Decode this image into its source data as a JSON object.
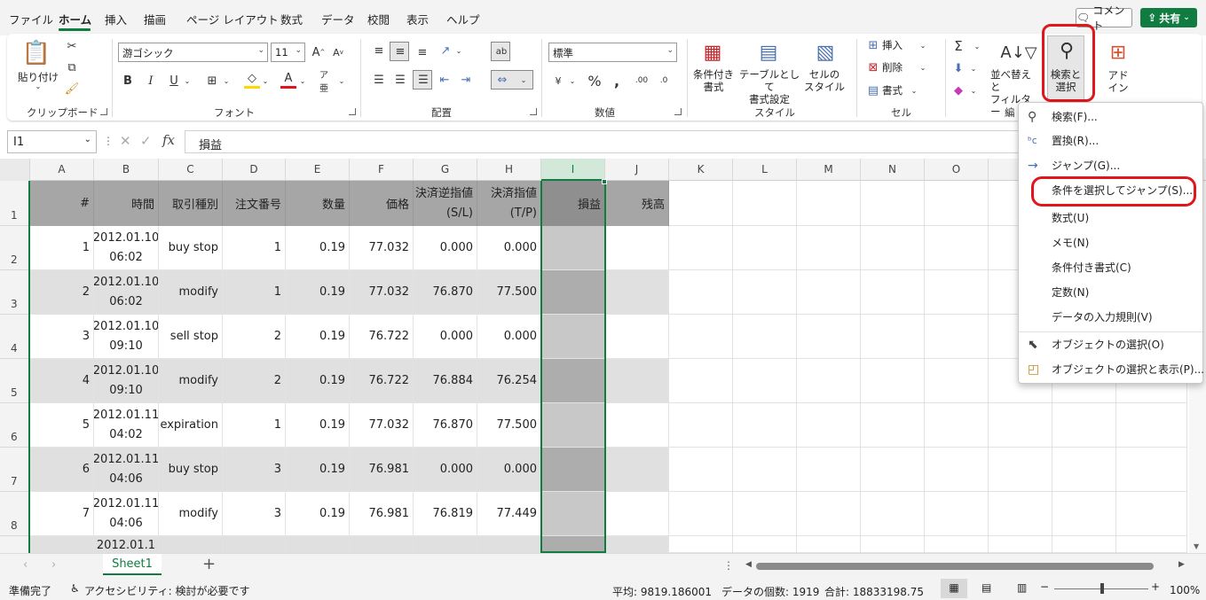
{
  "menu": {
    "tabs": [
      "ファイル",
      "ホーム",
      "挿入",
      "描画",
      "ページ レイアウト",
      "数式",
      "データ",
      "校閲",
      "表示",
      "ヘルプ"
    ],
    "comment": "コメント",
    "share": "共有"
  },
  "ribbon": {
    "clipboard": {
      "paste": "貼り付け",
      "label": "クリップボード"
    },
    "font": {
      "name": "游ゴシック",
      "size": "11",
      "label": "フォント",
      "bold": "B",
      "italic": "I",
      "underline": "U"
    },
    "alignment": {
      "label": "配置"
    },
    "number": {
      "format": "標準",
      "label": "数値",
      "percent": "%"
    },
    "styles": {
      "conditional": "条件付き\n書式",
      "table": "テーブルとして\n書式設定",
      "cell": "セルの\nスタイル",
      "label": "スタイル"
    },
    "cells": {
      "insert": "挿入",
      "delete": "削除",
      "format": "書式",
      "label": "セル"
    },
    "editing": {
      "sort": "並べ替えと\nフィルター",
      "find": "検索と\n選択",
      "label": "編"
    },
    "addin": {
      "label": "アド\nイン"
    }
  },
  "formula_bar": {
    "name_box": "I1",
    "formula": "損益"
  },
  "columns": [
    "A",
    "B",
    "C",
    "D",
    "E",
    "F",
    "G",
    "H",
    "I",
    "J",
    "K",
    "L",
    "M",
    "N",
    "O"
  ],
  "rows": [
    "1",
    "2",
    "3",
    "4",
    "5",
    "6",
    "7",
    "8"
  ],
  "table": {
    "headers": [
      "#",
      "時間",
      "取引種別",
      "注文番号",
      "数量",
      "価格",
      "決済逆指値(S/L)",
      "決済指値(T/P)",
      "損益",
      "残高"
    ],
    "data": [
      [
        "1",
        "2012.01.10 06:02",
        "buy stop",
        "1",
        "0.19",
        "77.032",
        "0.000",
        "0.000"
      ],
      [
        "2",
        "2012.01.10 06:02",
        "modify",
        "1",
        "0.19",
        "77.032",
        "76.870",
        "77.500"
      ],
      [
        "3",
        "2012.01.10 09:10",
        "sell stop",
        "2",
        "0.19",
        "76.722",
        "0.000",
        "0.000"
      ],
      [
        "4",
        "2012.01.10 09:10",
        "modify",
        "2",
        "0.19",
        "76.722",
        "76.884",
        "76.254"
      ],
      [
        "5",
        "2012.01.11 04:02",
        "expiration",
        "1",
        "0.19",
        "77.032",
        "76.870",
        "77.500"
      ],
      [
        "6",
        "2012.01.11 04:06",
        "buy stop",
        "3",
        "0.19",
        "76.981",
        "0.000",
        "0.000"
      ],
      [
        "7",
        "2012.01.11 04:06",
        "modify",
        "3",
        "0.19",
        "76.981",
        "76.819",
        "77.449"
      ]
    ],
    "partial_date": "2012.01.1"
  },
  "dropdown": {
    "items": [
      {
        "label": "検索(F)...",
        "icon": "search-icon"
      },
      {
        "label": "置換(R)...",
        "icon": "replace-icon"
      },
      {
        "label": "ジャンプ(G)...",
        "icon": "arrow-right-icon"
      },
      {
        "label": "条件を選択してジャンプ(S)...",
        "icon": ""
      },
      {
        "label": "数式(U)",
        "icon": ""
      },
      {
        "label": "メモ(N)",
        "icon": ""
      },
      {
        "label": "条件付き書式(C)",
        "icon": ""
      },
      {
        "label": "定数(N)",
        "icon": ""
      },
      {
        "label": "データの入力規則(V)",
        "icon": ""
      },
      {
        "label": "オブジェクトの選択(O)",
        "icon": "pointer-icon"
      },
      {
        "label": "オブジェクトの選択と表示(P)...",
        "icon": "selection-pane-icon"
      }
    ]
  },
  "sheet": {
    "tab": "Sheet1"
  },
  "status": {
    "ready": "準備完了",
    "accessibility": "アクセシビリティ: 検討が必要です",
    "average": "平均: 9819.186001",
    "count": "データの個数: 1919",
    "sum": "合計: 18833198.75",
    "zoom": "100%"
  },
  "colors": {
    "accent": "#107c41",
    "highlight": "#e0161c",
    "header_fill": "#a6a6a6",
    "band_fill": "#e0e0e0"
  }
}
